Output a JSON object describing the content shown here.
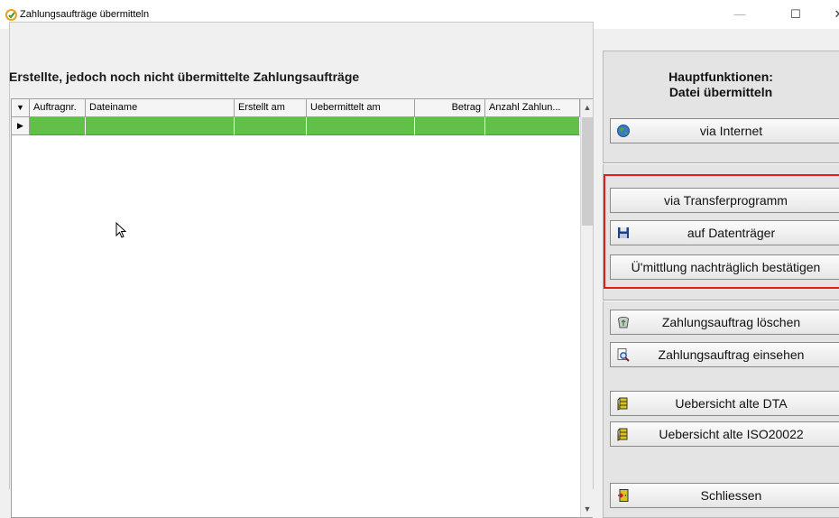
{
  "window": {
    "title": "Zahlungsaufträge übermitteln",
    "min_symbol": "—",
    "max_symbol": "☐",
    "close_symbol": "✕"
  },
  "left": {
    "section_title": "Erstellte, jedoch noch nicht übermittelte Zahlungsaufträge",
    "grid": {
      "columns": [
        "Auftragnr.",
        "Dateiname",
        "Erstellt am",
        "Uebermittelt am",
        "Betrag",
        "Anzahl Zahlun..."
      ],
      "rows": [
        {
          "cells": [
            "",
            "",
            "",
            "",
            "",
            ""
          ],
          "selected": true,
          "color": "#62c04a"
        }
      ]
    }
  },
  "right": {
    "title_line1": "Hauptfunktionen:",
    "title_line2": "Datei übermitteln",
    "buttons": {
      "internet": {
        "label": "via Internet",
        "icon": "globe-icon"
      },
      "transfer": {
        "label": "via Transferprogramm"
      },
      "datentraeger": {
        "label": "auf Datenträger",
        "icon": "floppy-disk-icon"
      },
      "bestaetigen": {
        "label": "Ü'mittlung nachträglich bestätigen"
      },
      "loeschen": {
        "label": "Zahlungsauftrag löschen",
        "icon": "recycle-bin-icon"
      },
      "einsehen": {
        "label": "Zahlungsauftrag einsehen",
        "icon": "document-magnifier-icon"
      },
      "alte_dta": {
        "label": "Uebersicht alte DTA",
        "icon": "file-cabinet-icon"
      },
      "alte_iso": {
        "label": "Uebersicht alte ISO20022",
        "icon": "file-cabinet-icon"
      },
      "schliessen": {
        "label": "Schliessen",
        "icon": "exit-door-icon"
      }
    },
    "highlight_color": "#e01e1e"
  }
}
